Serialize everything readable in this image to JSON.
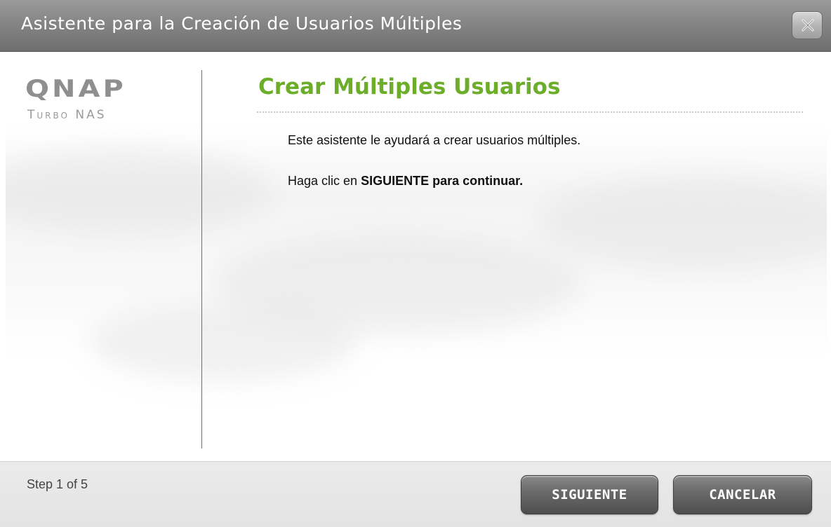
{
  "window": {
    "title": "Asistente para la Creación de Usuarios Múltiples",
    "close_icon": "close-x-icon"
  },
  "brand": {
    "logo_text": "QNAP",
    "logo_sub": "Turbo NAS"
  },
  "content": {
    "heading": "Crear Múltiples Usuarios",
    "line1": "Este asistente le ayudará a crear usuarios múltiples.",
    "line2_prefix": "Haga clic en ",
    "line2_bold": "SIGUIENTE para continuar."
  },
  "footer": {
    "step": "Step 1 of 5",
    "next_label": "SIGUIENTE",
    "cancel_label": "CANCELAR"
  },
  "colors": {
    "heading_green": "#6cae2a",
    "titlebar_gray": "#858585",
    "button_dark": "#5a5a5a"
  }
}
